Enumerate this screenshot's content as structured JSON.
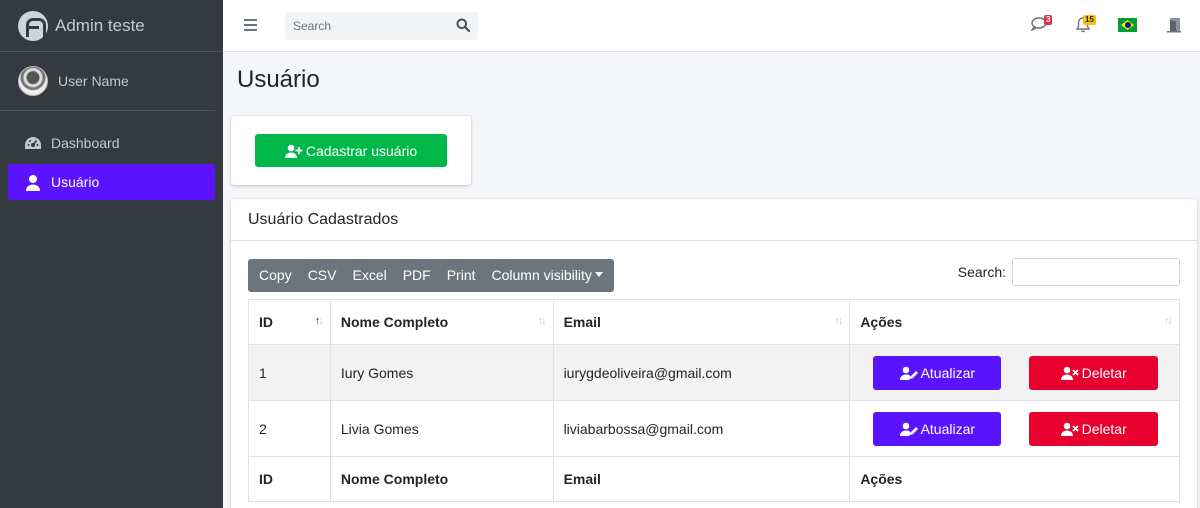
{
  "brand": {
    "title": "Admin teste"
  },
  "user": {
    "name": "User Name"
  },
  "sidebar": {
    "items": [
      {
        "label": "Dashboard",
        "icon": "tachometer-icon",
        "active": false
      },
      {
        "label": "Usuário",
        "icon": "user-icon",
        "active": true
      }
    ]
  },
  "topbar": {
    "search_placeholder": "Search",
    "messages_badge": "3",
    "notifications_badge": "15",
    "language": "Brasil"
  },
  "page": {
    "title": "Usuário"
  },
  "add_card": {
    "button_label": "Cadastrar usuário"
  },
  "table_card": {
    "title": "Usuário Cadastrados",
    "buttons": [
      "Copy",
      "CSV",
      "Excel",
      "PDF",
      "Print",
      "Column visibility"
    ],
    "search_label": "Search:",
    "columns": [
      "ID",
      "Nome Completo",
      "Email",
      "Ações"
    ],
    "rows": [
      {
        "id": "1",
        "name": "Iury Gomes",
        "email": "iurygdeoliveira@gmail.com"
      },
      {
        "id": "2",
        "name": "Livia Gomes",
        "email": "liviabarbossa@gmail.com"
      }
    ],
    "update_label": "Atualizar",
    "delete_label": "Deletar"
  },
  "colors": {
    "sidebar_bg": "#343a40",
    "accent": "#5a13ff",
    "success": "#00b84a",
    "danger": "#e8002f"
  }
}
